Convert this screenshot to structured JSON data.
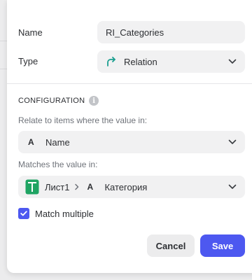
{
  "form": {
    "name_label": "Name",
    "name_value": "RI_Categories",
    "type_label": "Type",
    "type_value": "Relation"
  },
  "configuration": {
    "title": "CONFIGURATION",
    "info_glyph": "i",
    "relate_hint": "Relate to items where the value in:",
    "relate_field_icon": "A",
    "relate_field": "Name",
    "matches_hint": "Matches the value in:",
    "sheet": "Лист1",
    "match_field_icon": "A",
    "match_field": "Категория",
    "match_multiple_label": "Match multiple",
    "match_multiple_checked": true
  },
  "actions": {
    "cancel_label": "Cancel",
    "save_label": "Save"
  },
  "colors": {
    "accent": "#4d58f0",
    "relation_icon": "#1a9e8f",
    "sheet_icon": "#1fa463"
  }
}
